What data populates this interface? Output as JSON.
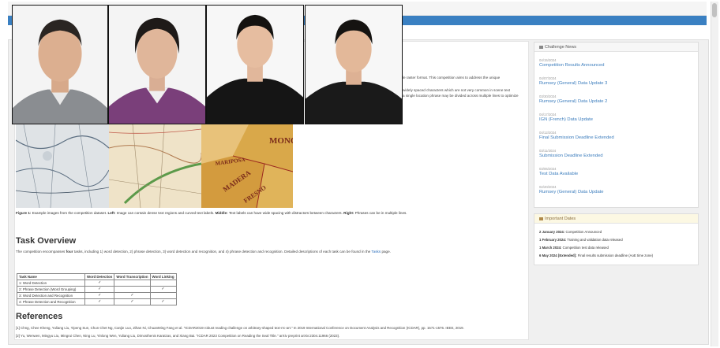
{
  "intro": {
    "fragment_1": "le raster format. This competition aims to address the unique",
    "fragment_2": "widely spaced characters which are not very common in scene text",
    "fragment_3": "a single location phrase may be divided across multiple lines to optimize"
  },
  "figure": {
    "caption_label": "Figure 1:",
    "caption_text": "Example images from the competition dataset.",
    "left_label": "Left:",
    "left_text": "Image can contain dense text regions and curved text labels.",
    "middle_label": "Middle:",
    "middle_text": "Text labels can have wide spacing with distractors between characters.",
    "right_label": "Right:",
    "right_text": "Phrases can be in multiple lines.",
    "map_labels": [
      "MONO",
      "MARIPOSA",
      "MADERA",
      "FRESNO"
    ]
  },
  "task_overview": {
    "heading": "Task Overview",
    "desc_prefix": "The competition encompasses",
    "desc_bold": "four",
    "desc_main": "tasks, including 1) word detection, 2) phrase detection, 3) word detection and recognition, and 4) phrase detection and recognition. Detailed descriptions of each task can be found in the",
    "desc_link": "Tasks",
    "desc_suffix": "page.",
    "table": {
      "headers": [
        "Task Name",
        "Word Detection",
        "Word Transcription",
        "Word Linking"
      ],
      "rows": [
        {
          "name": "1: Word Detection",
          "det": "✓",
          "trans": "",
          "link": ""
        },
        {
          "name": "2: Phrase Detection (Word Grouping)",
          "det": "✓",
          "trans": "",
          "link": "✓"
        },
        {
          "name": "3: Word Detection and Recognition",
          "det": "✓",
          "trans": "✓",
          "link": ""
        },
        {
          "name": "4: Phrase Detection and Recognition",
          "det": "✓",
          "trans": "✓",
          "link": "✓"
        }
      ]
    }
  },
  "references": {
    "heading": "References",
    "items": [
      "[1] Chng, Chee Kheng, Yuliang Liu, Yipeng Sun, Chun Chet Ng, Canjie Luo, Zihan Ni, ChuanMing Fang et al. \"ICDAR2019 robust reading challenge on arbitrary-shaped text-rrc-art.\" In 2019 International Conference on Document Analysis and Recognition (ICDAR), pp. 1571-1576. IEEE, 2019.",
      "[2] Yu, Wenwen, Mingyu Liu, Mingrui Chen, Ning Lu, Yinlong Wen, Yuliang Liu, Dimosthenis Karatzas, and Xiang Bai. \"ICDAR 2023 Competition on Reading the Seal Title.\" arXiv preprint arXiv:2304.11966 (2023)."
    ]
  },
  "news": {
    "heading": "Challenge News",
    "items": [
      {
        "date": "04/15/2024",
        "title": "Competition Results Announced"
      },
      {
        "date": "04/07/2024",
        "title": "Rumsey (General) Data Update 3"
      },
      {
        "date": "03/30/2024",
        "title": "Rumsey (General) Data Update 2"
      },
      {
        "date": "04/17/2024",
        "title": "IGN (French) Data Update"
      },
      {
        "date": "04/12/2024",
        "title": "Final Submission Deadline Extended"
      },
      {
        "date": "03/11/2024",
        "title": "Submission Deadline Extended"
      },
      {
        "date": "03/06/2024",
        "title": "Test Data Available"
      },
      {
        "date": "02/20/2024",
        "title": "Rumsey (General) Data Update"
      }
    ]
  },
  "important_dates": {
    "heading": "Important Dates",
    "items": [
      {
        "date": "2 January 2024:",
        "text": "Competition Announced"
      },
      {
        "date": "1 February 2024:",
        "text": "Training and validation data released"
      },
      {
        "date": "1 March 2024:",
        "text": "Competition test data released"
      },
      {
        "date": "6 May 2024 [Extended]:",
        "text": "Final results submission deadline (AoE time zone)"
      }
    ]
  },
  "colors": {
    "navbar": "#3a80c2",
    "link": "#3c7dbd",
    "dates_header": "#fcf8e3"
  }
}
